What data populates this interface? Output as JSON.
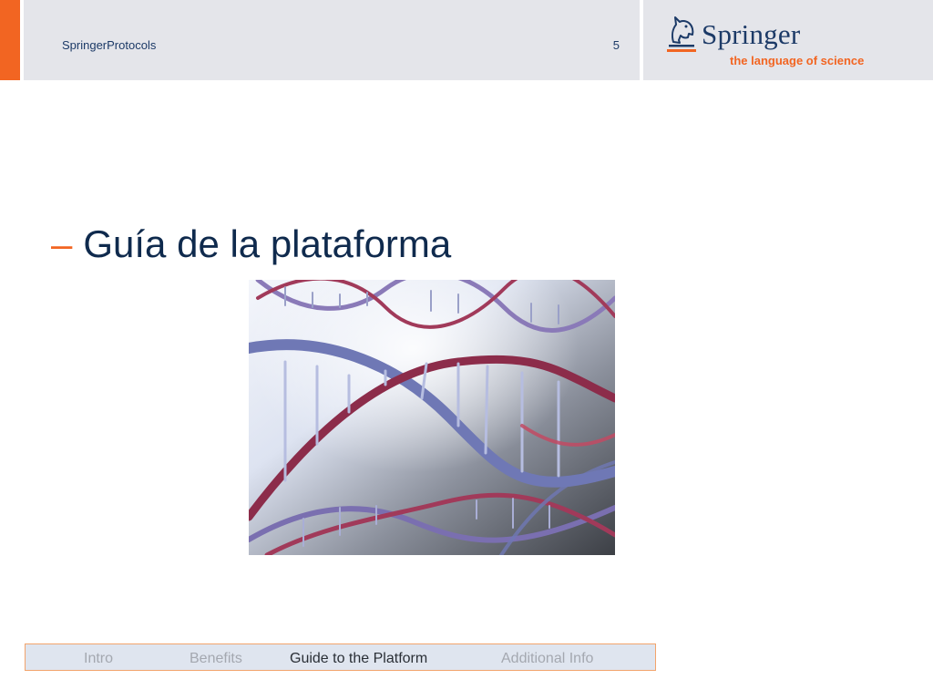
{
  "header": {
    "title": "SpringerProtocols",
    "page_number": "5"
  },
  "logo": {
    "name": "Springer",
    "tagline": "the language of science",
    "icon": "knight-horse-icon"
  },
  "slide": {
    "dash": "–",
    "heading": "Guía de la plataforma",
    "image": "dna-double-helix-image"
  },
  "footer_nav": {
    "items": [
      {
        "label": "Intro",
        "active": false
      },
      {
        "label": "Benefits",
        "active": false
      },
      {
        "label": "Guide to the Platform",
        "active": true
      },
      {
        "label": "Additional Info",
        "active": false
      }
    ]
  },
  "colors": {
    "accent": "#f26522",
    "brand_navy": "#1c3a67",
    "header_bg": "#e4e5ea",
    "nav_bg": "#dfe5ef"
  }
}
